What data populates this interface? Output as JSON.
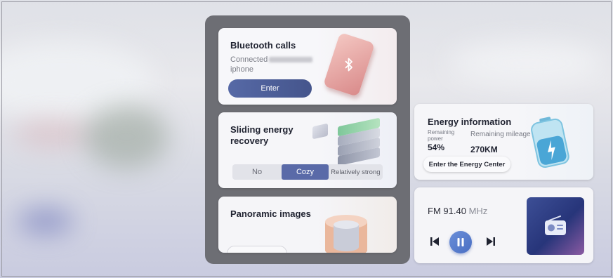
{
  "bluetooth": {
    "title": "Bluetooth calls",
    "status": "Connected",
    "device": "iphone",
    "enter_label": "Enter"
  },
  "energy_recovery": {
    "title": "Sliding energy recovery",
    "options": [
      "No",
      "Cozy",
      "Relatively strong"
    ],
    "selected": "Cozy"
  },
  "panoramic": {
    "title": "Panoramic images"
  },
  "energy_info": {
    "title": "Energy information",
    "power_label": "Remaining power",
    "power_value": "54%",
    "mileage_label": "Remaining mileage",
    "mileage_value": "270KM",
    "center_label": "Enter the Energy Center"
  },
  "radio": {
    "band": "FM",
    "frequency": "91.40",
    "unit": "MHz"
  },
  "colors": {
    "accent": "#5a6aa8",
    "play": "#4a6fc3",
    "panel": "#6d6e74"
  },
  "icons": [
    "bluetooth-icon",
    "battery-icon",
    "previous-icon",
    "pause-icon",
    "next-icon",
    "radio-icon"
  ]
}
